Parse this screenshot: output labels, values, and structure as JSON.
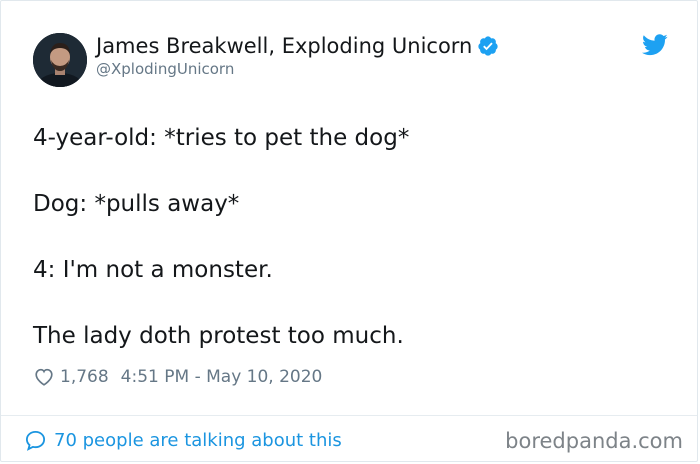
{
  "author": {
    "display_name": "James Breakwell, Exploding Unicorn",
    "handle": "@XplodingUnicorn",
    "verified": true
  },
  "tweet": {
    "lines": [
      "4-year-old: *tries to pet the dog*",
      "Dog: *pulls away*",
      "4: I'm not a monster.",
      "The lady doth protest too much."
    ],
    "like_count": "1,768",
    "timestamp": "4:51 PM - May 10, 2020"
  },
  "footer": {
    "talking_text": "70 people are talking about this"
  },
  "watermark": "boredpanda.com",
  "icons": {
    "verified": "verified-badge-icon",
    "platform": "twitter-bird-icon",
    "like": "heart-icon",
    "replies": "speech-bubble-icon"
  },
  "colors": {
    "accent": "#1da1f2",
    "link": "#1b95e0",
    "text": "#14171a",
    "muted": "#657786"
  }
}
